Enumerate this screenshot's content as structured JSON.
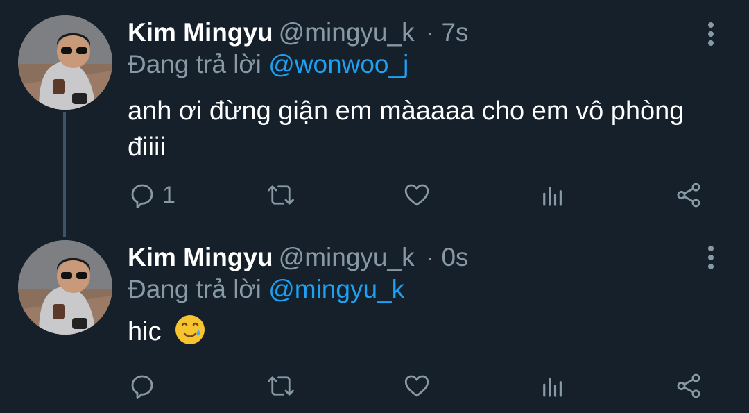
{
  "tweets": [
    {
      "name": "Kim Mingyu",
      "handle": "@mingyu_k",
      "time": "· 7s",
      "reply_prefix": "Đang trả lời",
      "reply_to": "@wonwoo_j",
      "text": "anh ơi đừng giận em màaaaa cho em vô phòng điiii",
      "reply_count": "1"
    },
    {
      "name": "Kim Mingyu",
      "handle": "@mingyu_k",
      "time": "· 0s",
      "reply_prefix": "Đang trả lời",
      "reply_to": "@mingyu_k",
      "text": "hic",
      "emoji": "🥲",
      "reply_count": ""
    }
  ],
  "icons": [
    "reply-icon",
    "retweet-icon",
    "like-icon",
    "analytics-icon",
    "share-icon",
    "more-icon"
  ],
  "colors": {
    "background": "#15202b",
    "text": "#ffffff",
    "muted": "#8899a6",
    "link": "#1da1f2"
  }
}
